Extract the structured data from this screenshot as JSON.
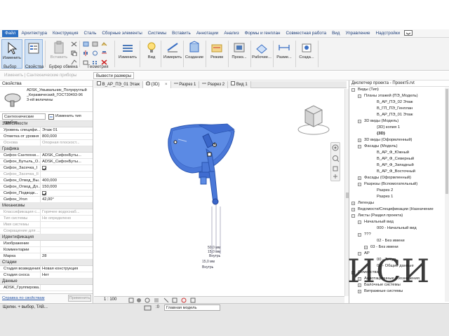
{
  "menu": {
    "items": [
      "Файл",
      "Архитектура",
      "Конструкция",
      "Сталь",
      "Сборные элементы",
      "Системы",
      "Вставить",
      "Аннотации",
      "Анализ",
      "Формы и генплан",
      "Совместная работа",
      "Вид",
      "Управление",
      "Надстройки"
    ],
    "active_index": 0
  },
  "ribbon": {
    "modify_label": "Изменить",
    "insert_label": "Вставить",
    "buttons": [
      {
        "label": "Изменить",
        "icon": "modify-icon"
      },
      {
        "label": "Вид",
        "icon": "view-icon"
      },
      {
        "label": "Измерить",
        "icon": "measure-icon"
      },
      {
        "label": "Создание",
        "icon": "create-icon"
      },
      {
        "label": "Режим",
        "icon": "mode-icon"
      },
      {
        "label": "Произ...",
        "icon": "work-icon"
      },
      {
        "label": "Рабочие...",
        "icon": "workplane-icon"
      },
      {
        "label": "Разме...",
        "icon": "dimension-icon"
      },
      {
        "label": "Созда...",
        "icon": "create-family-icon"
      }
    ],
    "groups": [
      "Выбор",
      "Свойства",
      "Буфер обмена",
      "Геометрия"
    ],
    "context_label": "Изменить | Сантехнические приборы",
    "dimension_button": "Вывести размеры"
  },
  "properties": {
    "title": "Свойства",
    "type_name_1": "ADSK_Умывальник_Полукруглый",
    "type_name_2": "_Керамический_ГОСТ30493-96",
    "type_name_3": "3-ей величины",
    "filter": "Сантехнические прибор",
    "edit_type": "Изменить тип",
    "section_deps": "Зависимости",
    "rows_deps": [
      {
        "k": "Уровень специфи...",
        "v": "Этаж 01",
        "grey": false
      },
      {
        "k": "Отметка от уровня",
        "v": "800,000",
        "grey": false
      },
      {
        "k": "Основа",
        "v": "Опорная плоскост...",
        "grey": true
      }
    ],
    "section_graphics": "Графика",
    "rows_graphics": [
      {
        "k": "Сифон Сантехни...",
        "v": "ADSK_СифонБуты...",
        "grey": false
      },
      {
        "k": "Сифон_Бутыль_О...",
        "v": "ADSK_СифонБуты...",
        "grey": false
      },
      {
        "k": "Сифон_Засечка_I",
        "v": "",
        "check": true,
        "grey": false
      },
      {
        "k": "Сифон_Засечка_II",
        "v": "",
        "grey": true
      },
      {
        "k": "Сифон_Отвод_Вы...",
        "v": "400,000",
        "grey": false
      },
      {
        "k": "Сифон_Отвод_Дл...",
        "v": "150,000",
        "grey": false
      },
      {
        "k": "Сифон_Подводк...",
        "v": "",
        "check": true,
        "grey": false
      },
      {
        "k": "Сифон_Угол",
        "v": "42,00°",
        "grey": false
      }
    ],
    "section_mech": "Механизмы",
    "rows_mech": [
      {
        "k": "Классификация с...",
        "v": "Горячее водоснаб...",
        "grey": true
      },
      {
        "k": "Тип системы",
        "v": "Не определено",
        "grey": true
      },
      {
        "k": "Имя системы",
        "v": "",
        "grey": true
      },
      {
        "k": "Сокращение для ...",
        "v": "",
        "grey": true
      }
    ],
    "section_ident": "Идентификация",
    "rows_ident": [
      {
        "k": "Изображение",
        "v": "",
        "grey": false
      },
      {
        "k": "Комментарии",
        "v": "",
        "grey": false
      },
      {
        "k": "Марка",
        "v": "28",
        "grey": false
      }
    ],
    "section_stages": "Стадии",
    "rows_stages": [
      {
        "k": "Стадия возведения",
        "v": "Новая конструкция",
        "grey": false
      },
      {
        "k": "Стадия сноса",
        "v": "Нет",
        "grey": false
      }
    ],
    "section_data": "Данные",
    "rows_data": [
      {
        "k": "ADSK_Группирова...",
        "v": "",
        "grey": false
      }
    ],
    "help_link": "Справка по свойствам",
    "apply": "Применить"
  },
  "tabs": [
    {
      "label": "В_АР_ПЭ_01 Этаж",
      "active": false
    },
    {
      "label": "{3D}",
      "active": true
    },
    {
      "label": "Разрез 1",
      "active": false
    },
    {
      "label": "Разрез 2",
      "active": false
    },
    {
      "label": "Вид 1",
      "active": false
    }
  ],
  "canvas": {
    "dim1": "50,0 мм",
    "dim2": "15,0 мм",
    "dim3": "Внутрь",
    "dim4": "15,0 мм",
    "dim5": "Внутрь"
  },
  "viewbar": {
    "scale": "1 : 100"
  },
  "browser": {
    "title": "Диспетчер проекта - Проект5.rvt",
    "nodes": [
      {
        "t": "−",
        "l": "Виды (Тип)",
        "d": 0,
        "icon": true
      },
      {
        "t": "−",
        "l": "Планы этажей (ПЭ_Модель)",
        "d": 1
      },
      {
        "t": "",
        "l": "В_АР_ПЭ_02 Этаж",
        "d": 3
      },
      {
        "t": "",
        "l": "В_ГП_ПЭ_Генплан",
        "d": 3
      },
      {
        "t": "",
        "l": "В_АР_ПЭ_01 Этаж",
        "d": 3
      },
      {
        "t": "−",
        "l": "3D виды (Модель)",
        "d": 1
      },
      {
        "t": "",
        "l": "{3D} копия 1",
        "d": 3
      },
      {
        "t": "",
        "l": "{3D}",
        "d": 3,
        "bold": true
      },
      {
        "t": "+",
        "l": "3D виды (Оформленный)",
        "d": 1
      },
      {
        "t": "−",
        "l": "Фасады (Модель)",
        "d": 1
      },
      {
        "t": "",
        "l": "В_АР_Ф_Южный",
        "d": 3
      },
      {
        "t": "",
        "l": "В_АР_Ф_Северный",
        "d": 3
      },
      {
        "t": "",
        "l": "В_АР_Ф_Западный",
        "d": 3
      },
      {
        "t": "",
        "l": "В_АР_Ф_Восточный",
        "d": 3
      },
      {
        "t": "+",
        "l": "Фасады (Оформленный)",
        "d": 1
      },
      {
        "t": "−",
        "l": "Разрезы (Вспомогательный)",
        "d": 1
      },
      {
        "t": "",
        "l": "Разрез 2",
        "d": 3
      },
      {
        "t": "",
        "l": "Разрез 1",
        "d": 3
      },
      {
        "t": "+",
        "l": "Легенды",
        "d": 0
      },
      {
        "t": "+",
        "l": "Ведомости/Спецификации (Назначение",
        "d": 0
      },
      {
        "t": "−",
        "l": "Листы (Раздел проекта)",
        "d": 0
      },
      {
        "t": "−",
        "l": "Начальный вид",
        "d": 1
      },
      {
        "t": "",
        "l": "000 - Начальный вид",
        "d": 3
      },
      {
        "t": "−",
        "l": "???",
        "d": 1
      },
      {
        "t": "",
        "l": "02 - Без имени",
        "d": 3
      },
      {
        "t": "+",
        "l": "03 - Без имени",
        "d": 2
      },
      {
        "t": "−",
        "l": "АР",
        "d": 1
      },
      {
        "t": "",
        "l": "00 - Титул",
        "d": 3
      },
      {
        "t": "",
        "l": "01 - Общие данные",
        "d": 3
      },
      {
        "t": "+",
        "l": "Семейства",
        "d": 0
      },
      {
        "t": "+",
        "l": "Аннотационные обозначения",
        "d": 1
      },
      {
        "t": "+",
        "l": "Балочные системы",
        "d": 1
      },
      {
        "t": "+",
        "l": "Витражные системы",
        "d": 1
      }
    ]
  },
  "watermark": "ИСИ",
  "status": {
    "text": "Щелкн. + выбор, TAB...",
    "main_model": "Главная модель",
    "zero": ":0"
  }
}
